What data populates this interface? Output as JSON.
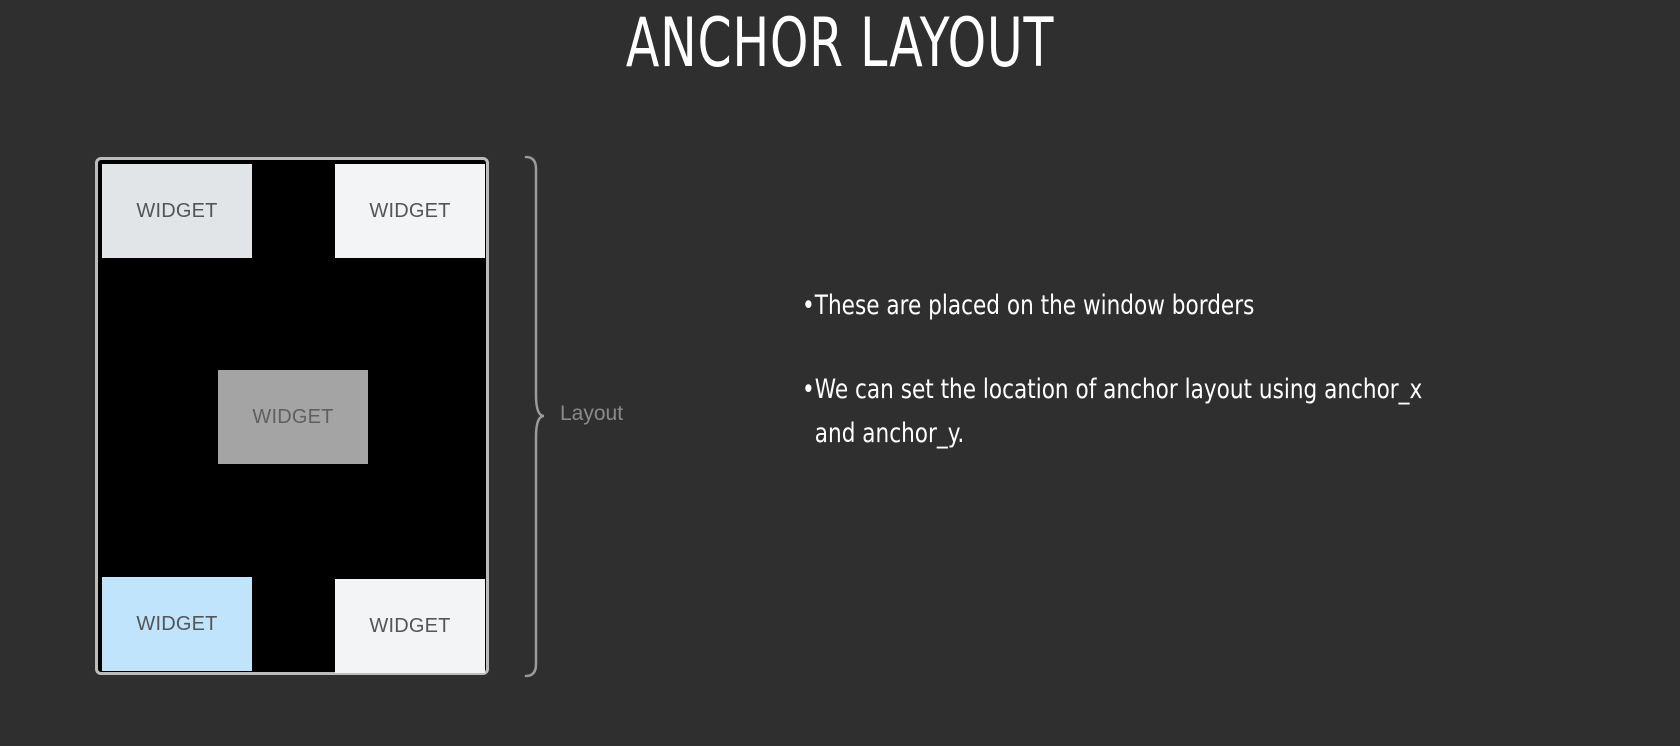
{
  "title": "ANCHOR LAYOUT",
  "diagram": {
    "widgets": {
      "top_left": "WIDGET",
      "top_right": "WIDGET",
      "center": "WIDGET",
      "bottom_left": "WIDGET",
      "bottom_right": "WIDGET"
    },
    "brace_label": "Layout"
  },
  "bullets": [
    "These are placed on the window borders",
    "We can set the location of anchor layout using anchor_x and anchor_y."
  ],
  "colors": {
    "background": "#2f2f2f",
    "window": "#000000",
    "widget_light": "#f2f4f5",
    "widget_gray": "#a4a4a4",
    "widget_blue": "#bfe4fc"
  }
}
